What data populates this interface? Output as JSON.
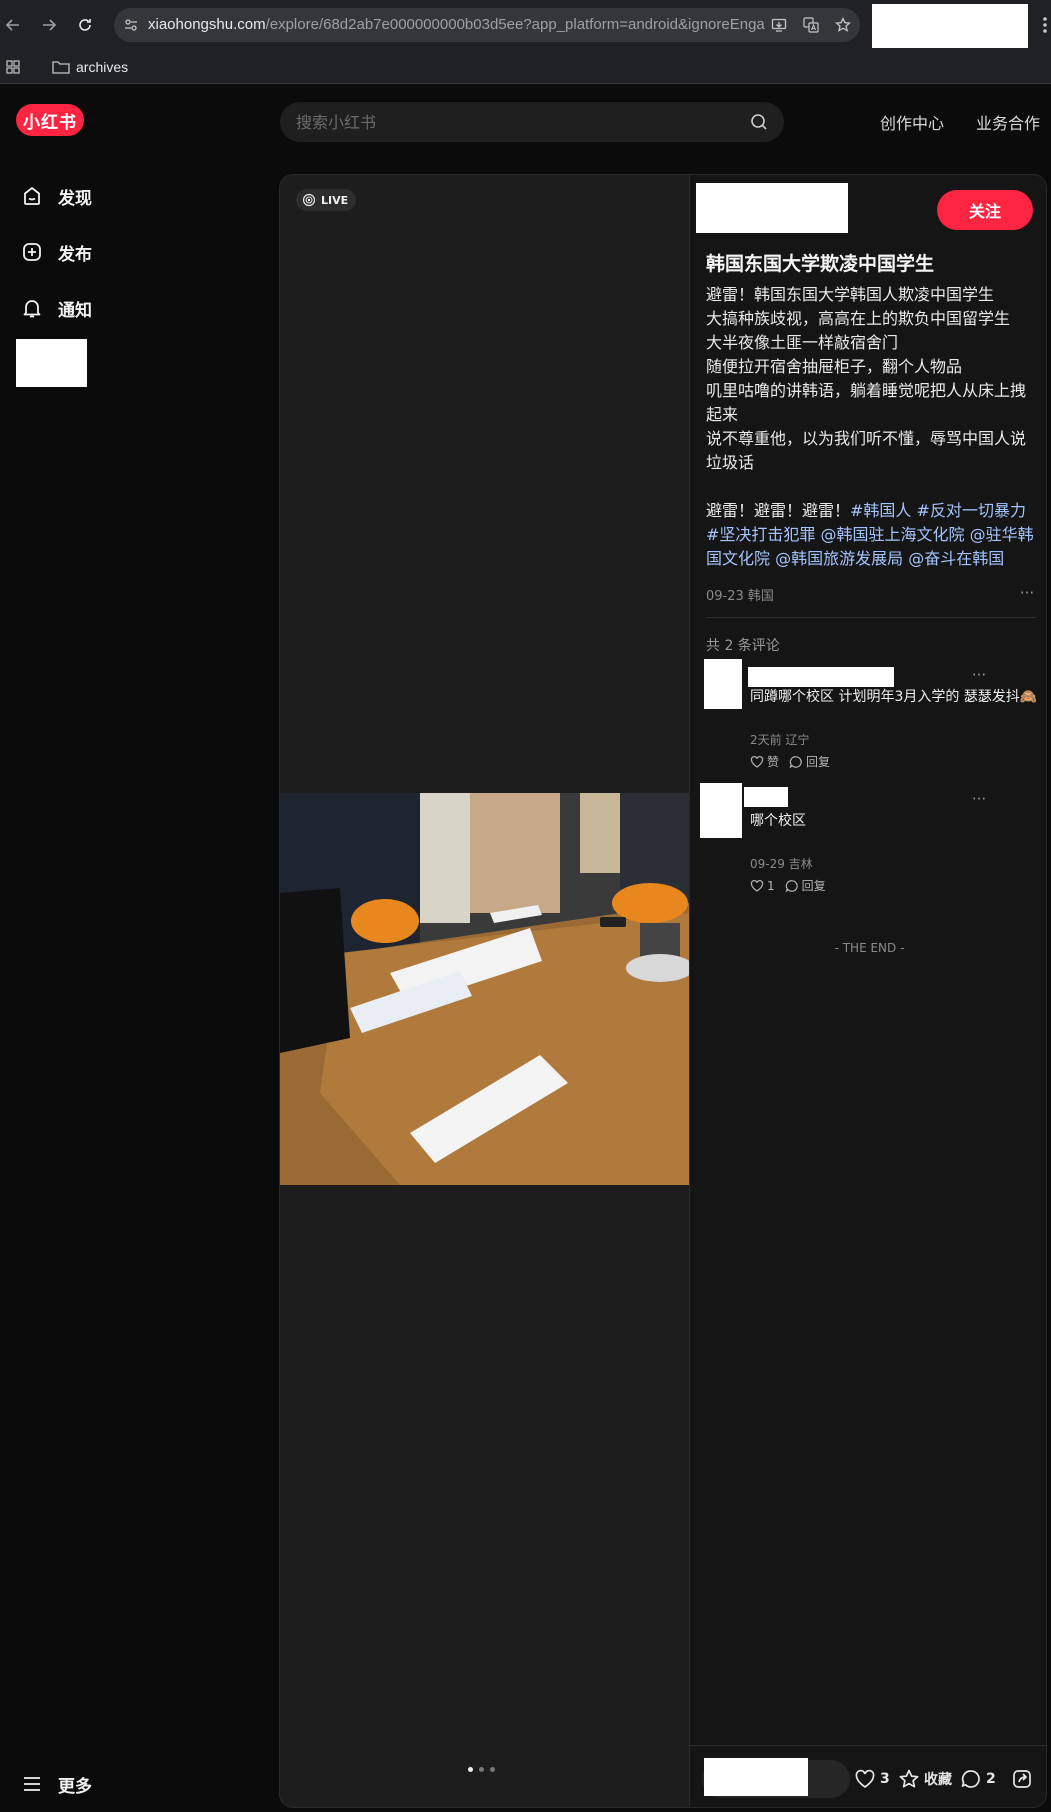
{
  "browser": {
    "url_host": "xiaohongshu.com",
    "url_path": "/explore/68d2ab7e000000000b03d5ee?app_platform=android&ignoreEnga...",
    "bookmark_folder": "archives"
  },
  "header": {
    "logo_text": "小红书",
    "search_placeholder": "搜索小红书",
    "links": [
      "创作中心",
      "业务合作"
    ]
  },
  "sidebar": {
    "items": [
      {
        "label": "发现",
        "icon": "discover-icon"
      },
      {
        "label": "发布",
        "icon": "plus-icon"
      },
      {
        "label": "通知",
        "icon": "bell-icon"
      }
    ],
    "more_label": "更多"
  },
  "note": {
    "live_label": "LIVE",
    "follow_label": "关注",
    "title": "韩国东国大学欺凌中国学生",
    "description_lines": [
      "避雷！韩国东国大学韩国人欺凌中国学生",
      "大搞种族歧视，高高在上的欺负中国留学生",
      "大半夜像土匪一样敲宿舍门",
      "随便拉开宿舍抽屉柜子，翻个人物品",
      "叽里咕噜的讲韩语，躺着睡觉呢把人从床上拽起来",
      "说不尊重他，以为我们听不懂，辱骂中国人说垃圾话",
      ""
    ],
    "tags_prefix": "避雷！避雷！避雷！",
    "tags": [
      "#韩国人",
      "#反对一切暴力",
      "#坚决打击犯罪",
      "@韩国驻上海文化院",
      "@驻华韩国文化院",
      "@韩国旅游发展局",
      "@奋斗在韩国"
    ],
    "meta": "09-23 韩国",
    "comment_count": "共 2 条评论",
    "the_end": "- THE END -",
    "image_count": 3,
    "active_image": 1
  },
  "comments": [
    {
      "text": "同蹲哪个校区 计划明年3月入学的 瑟瑟发抖🙈",
      "meta": "2天前 辽宁",
      "like_label": "赞",
      "reply_label": "回复"
    },
    {
      "text": "哪个校区",
      "meta": "09-29 吉林",
      "like_label": "1",
      "reply_label": "回复"
    }
  ],
  "engagement": {
    "likes": "3",
    "collect_label": "收藏",
    "comments": "2"
  },
  "colors": {
    "brand": "#ff2442",
    "background": "#0b0b0b",
    "card": "#1c1c1c",
    "tag": "#a4c4ff"
  }
}
